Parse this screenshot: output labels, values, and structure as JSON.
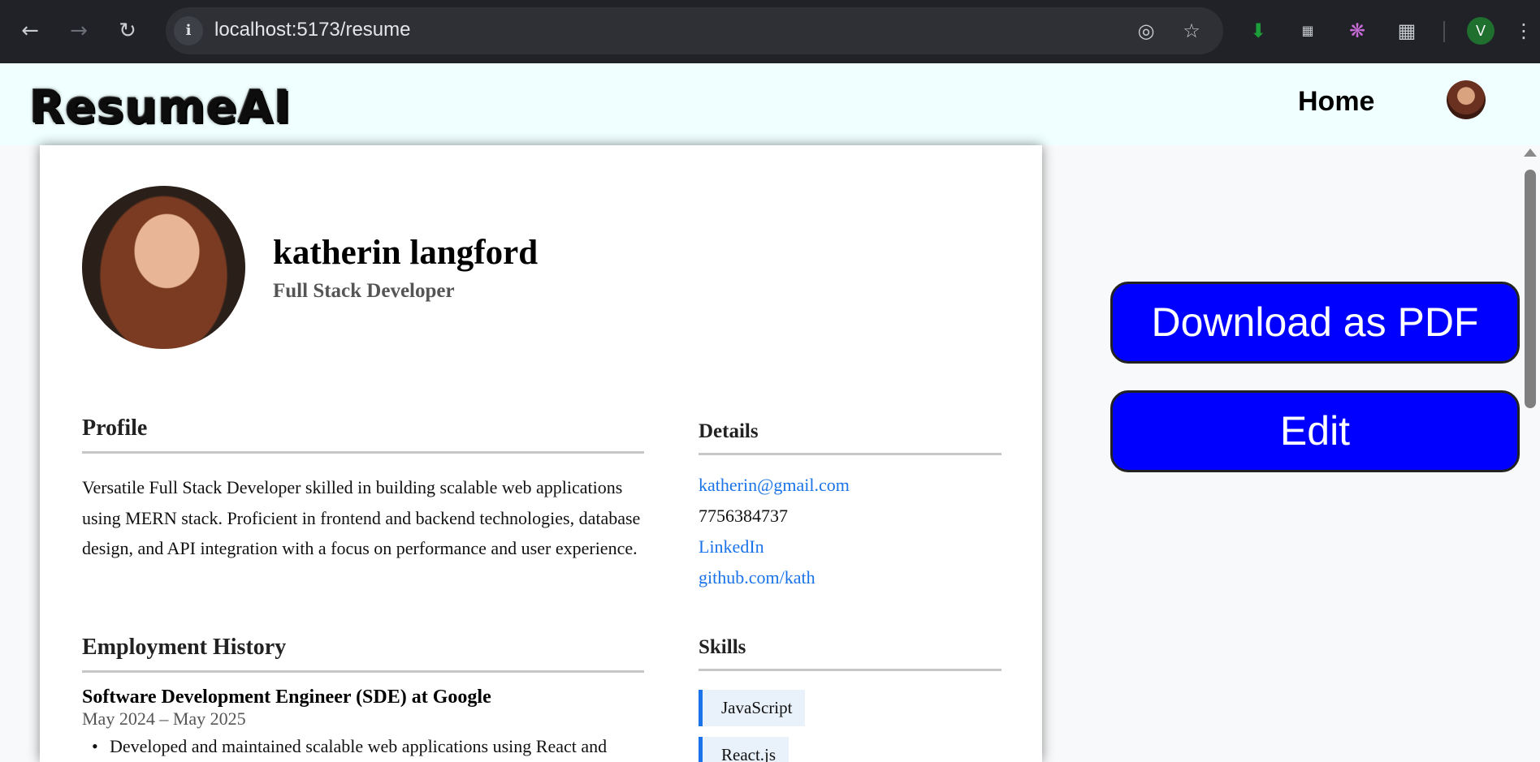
{
  "browser": {
    "url": "localhost:5173/resume",
    "profile_initial": "V"
  },
  "header": {
    "logo": "ResumeAI",
    "nav_home": "Home"
  },
  "resume": {
    "name": "katherin langford",
    "role": "Full Stack Developer",
    "profile": {
      "title": "Profile",
      "text": "Versatile Full Stack Developer skilled in building scalable web applications using MERN stack. Proficient in frontend and backend technologies, database design, and API integration with a focus on performance and user experience."
    },
    "details": {
      "title": "Details",
      "email": "katherin@gmail.com",
      "phone": "7756384737",
      "linkedin": "LinkedIn",
      "github": "github.com/kath"
    },
    "employment": {
      "title": "Employment History",
      "jobs": [
        {
          "title": "Software Development Engineer (SDE) at Google",
          "date": "May 2024 – May 2025",
          "bullets": [
            "Developed and maintained scalable web applications using React and"
          ]
        }
      ]
    },
    "skills": {
      "title": "Skills",
      "items": [
        "JavaScript",
        "React.js"
      ]
    }
  },
  "actions": {
    "download": "Download as PDF",
    "edit": "Edit"
  }
}
